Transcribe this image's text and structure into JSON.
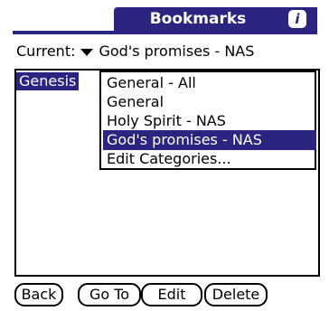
{
  "title": "Bookmarks",
  "info_icon": "info-icon",
  "current": {
    "label": "Current:",
    "selected": "God's promises - NAS"
  },
  "list": {
    "items": [
      "Genesis"
    ]
  },
  "popup": {
    "items": [
      "General - All",
      "General",
      "Holy Spirit - NAS",
      "God's promises - NAS",
      "Edit Categories..."
    ],
    "selected_index": 3
  },
  "buttons": {
    "back": "Back",
    "goto": "Go To",
    "edit": "Edit",
    "delete": "Delete"
  },
  "colors": {
    "accent": "#2b2480"
  }
}
